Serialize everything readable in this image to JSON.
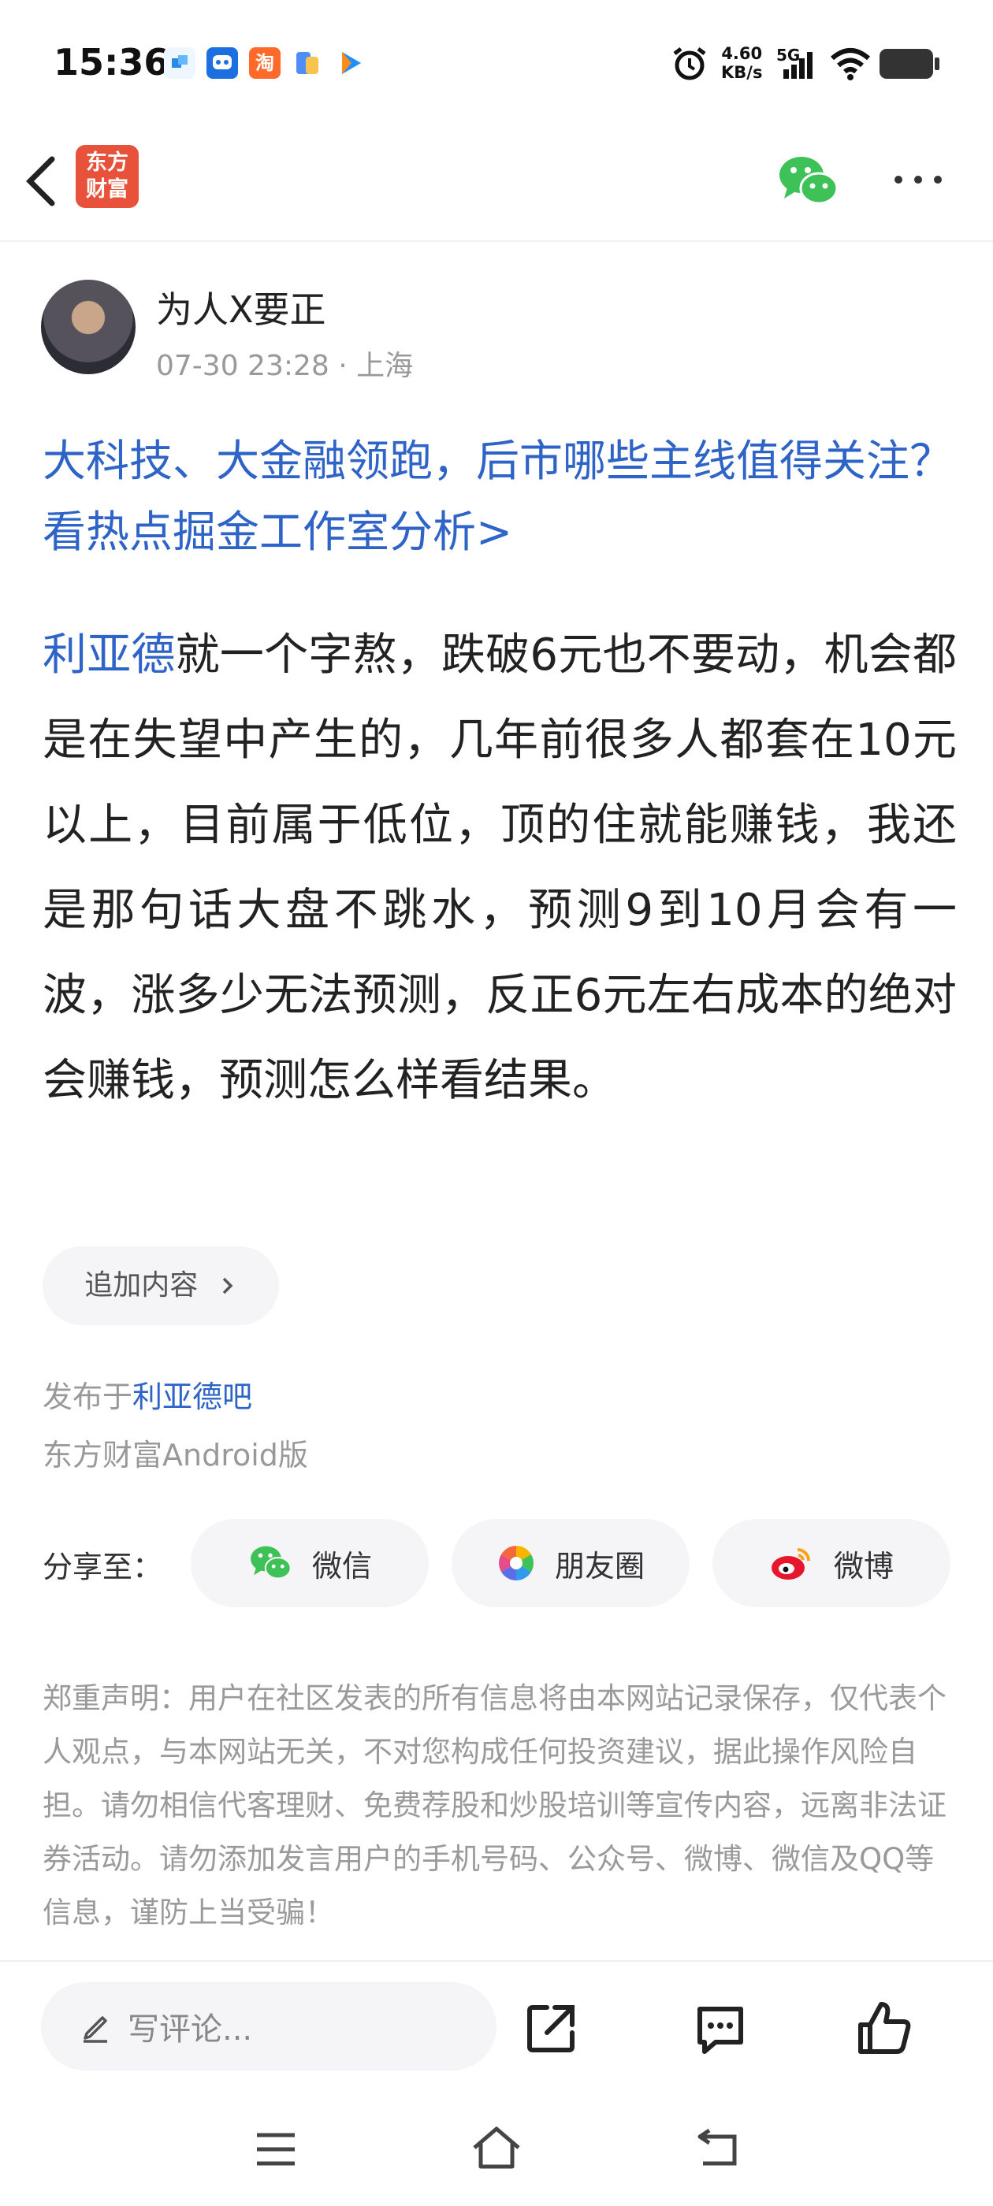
{
  "status_bar": {
    "time": "15:36",
    "net_speed_value": "4.60",
    "net_speed_unit": "KB/s",
    "network": "5G"
  },
  "nav": {
    "logo_line1": "东方",
    "logo_line2": "财富"
  },
  "post": {
    "author": "为人X要正",
    "meta": "07-30 23:28 · 上海",
    "headline": "大科技、大金融领跑，后市哪些主线值得关注？看热点掘金工作室分析>",
    "stock_name": "利亚德",
    "body": "就一个字熬，跌破6元也不要动，机会都是在失望中产生的，几年前很多人都套在10元以上，目前属于低位，顶的住就能赚钱，我还是那句话大盘不跳水，预测9到10月会有一波，涨多少无法预测，反正6元左右成本的绝对会赚钱，预测怎么样看结果。",
    "add_content_label": "追加内容",
    "published_prefix": "发布于",
    "forum_name": "利亚德吧",
    "client_info": "东方财富Android版"
  },
  "share": {
    "label": "分享至：",
    "targets": [
      "微信",
      "朋友圈",
      "微博"
    ]
  },
  "disclaimer": "郑重声明：用户在社区发表的所有信息将由本网站记录保存，仅代表个人观点，与本网站无关，不对您构成任何投资建议，据此操作风险自担。请勿相信代客理财、免费荐股和炒股培训等宣传内容，远离非法证券活动。请勿添加发言用户的手机号码、公众号、微博、微信及QQ等信息，谨防上当受骗！",
  "bottom_bar": {
    "comment_placeholder": "写评论..."
  },
  "colors": {
    "link": "#2e64c8",
    "brand": "#e8523a",
    "wechat": "#3ec157",
    "weibo": "#e6162d"
  },
  "icons": [
    "back-icon",
    "wechat-icon",
    "more-icon",
    "chevron-right-icon",
    "moments-icon",
    "weibo-icon",
    "pencil-icon",
    "share-out-icon",
    "comment-icon",
    "thumbs-up-icon",
    "menu-icon",
    "home-icon",
    "return-icon"
  ]
}
